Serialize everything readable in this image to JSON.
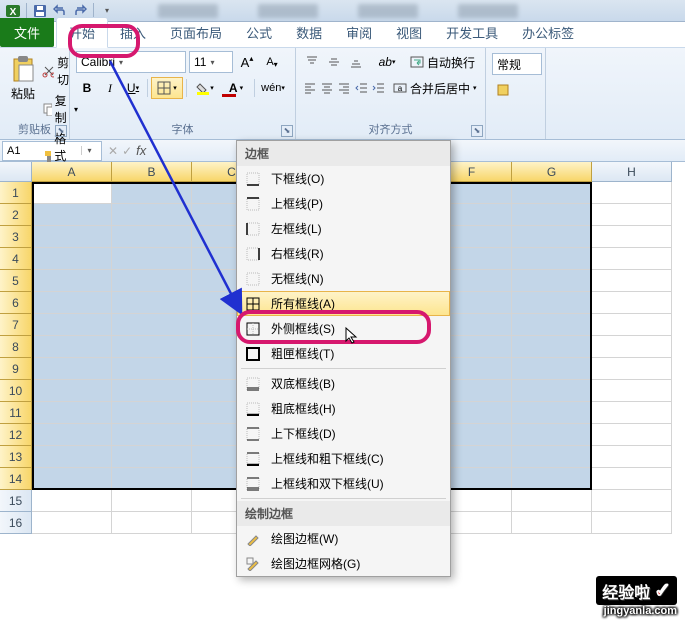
{
  "qat": {
    "save": "💾"
  },
  "tabs": {
    "file": "文件",
    "home": "开始",
    "insert": "插入",
    "layout": "页面布局",
    "formulas": "公式",
    "data": "数据",
    "review": "审阅",
    "view": "视图",
    "dev": "开发工具",
    "office": "办公标签"
  },
  "clipboard": {
    "paste": "粘贴",
    "cut": "剪切",
    "copy": "复制",
    "format_painter": "格式刷",
    "group": "剪贴板"
  },
  "font": {
    "name": "Calibri",
    "size": "11",
    "group": "字体",
    "bold": "B",
    "italic": "I",
    "underline": "U"
  },
  "align": {
    "wrap": "自动换行",
    "merge": "合并后居中",
    "group": "对齐方式"
  },
  "number": {
    "general": "常规"
  },
  "namebox": {
    "ref": "A1"
  },
  "cols": [
    "A",
    "B",
    "C",
    "D",
    "E",
    "F",
    "G",
    "H"
  ],
  "rows": [
    "1",
    "2",
    "3",
    "4",
    "5",
    "6",
    "7",
    "8",
    "9",
    "10",
    "11",
    "12",
    "13",
    "14",
    "15",
    "16"
  ],
  "dropdown": {
    "header": "边框",
    "items": [
      {
        "icon": "bb",
        "label": "下框线(O)"
      },
      {
        "icon": "bt",
        "label": "上框线(P)"
      },
      {
        "icon": "bl",
        "label": "左框线(L)"
      },
      {
        "icon": "br",
        "label": "右框线(R)"
      },
      {
        "icon": "bn",
        "label": "无框线(N)"
      },
      {
        "icon": "ba",
        "label": "所有框线(A)"
      },
      {
        "icon": "bo",
        "label": "外侧框线(S)"
      },
      {
        "icon": "bx",
        "label": "粗匣框线(T)"
      }
    ],
    "items2": [
      {
        "icon": "b2b",
        "label": "双底框线(B)"
      },
      {
        "icon": "btb",
        "label": "粗底框线(H)"
      },
      {
        "icon": "btd",
        "label": "上下框线(D)"
      },
      {
        "icon": "btc",
        "label": "上框线和粗下框线(C)"
      },
      {
        "icon": "btu",
        "label": "上框线和双下框线(U)"
      }
    ],
    "header2": "绘制边框",
    "items3": [
      {
        "icon": "pen",
        "label": "绘图边框(W)"
      },
      {
        "icon": "grid",
        "label": "绘图边框网格(G)"
      }
    ]
  },
  "watermark": {
    "top": "经验啦",
    "bot": "jingyanla.com"
  }
}
